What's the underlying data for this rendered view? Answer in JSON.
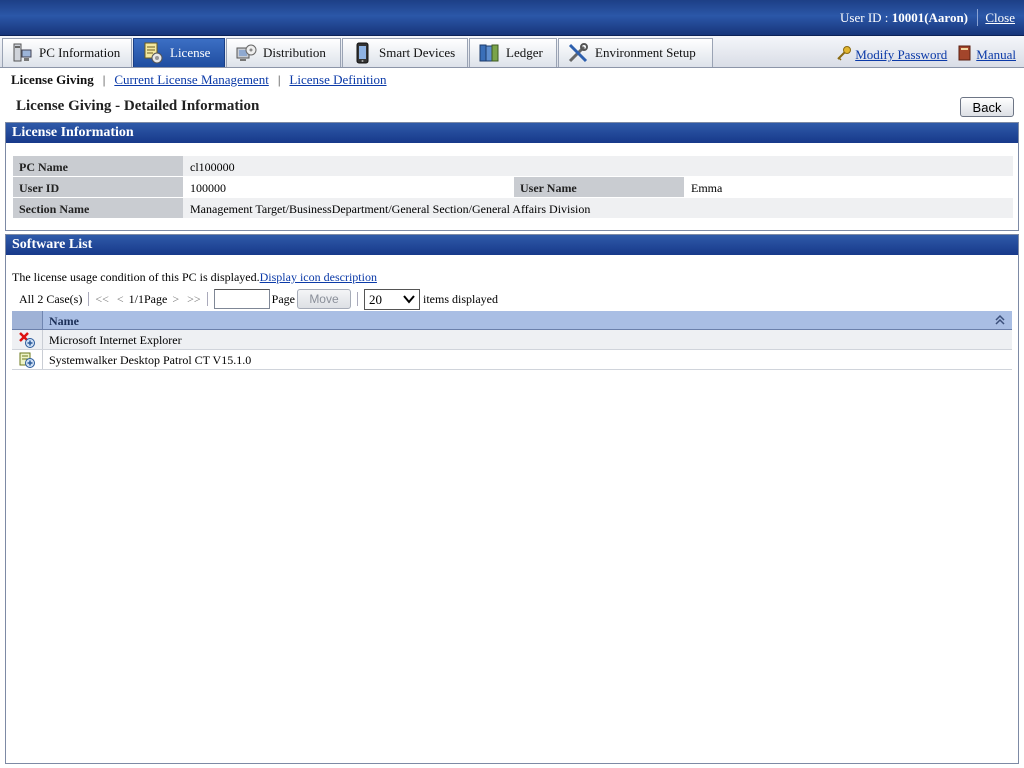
{
  "header": {
    "user_label": "User ID : ",
    "user_value": "10001(Aaron)",
    "close_label": "Close"
  },
  "tabs": [
    {
      "label": "PC Information",
      "icon": "pc-icon",
      "active": false
    },
    {
      "label": "License",
      "icon": "license-icon",
      "active": true
    },
    {
      "label": "Distribution",
      "icon": "distribution-icon",
      "active": false
    },
    {
      "label": "Smart Devices",
      "icon": "smart-device-icon",
      "active": false
    },
    {
      "label": "Ledger",
      "icon": "ledger-icon",
      "active": false
    },
    {
      "label": "Environment Setup",
      "icon": "tools-icon",
      "active": false
    }
  ],
  "top_links": {
    "modify_password": "Modify Password",
    "manual": "Manual"
  },
  "subnav": {
    "current": "License Giving",
    "links": [
      "Current License Management",
      "License Definition"
    ]
  },
  "page": {
    "title": "License Giving - Detailed Information",
    "back_label": "Back"
  },
  "license_info": {
    "section_title": "License Information",
    "pc_name_label": "PC Name",
    "pc_name": "cl100000",
    "user_id_label": "User ID",
    "user_id": "100000",
    "user_name_label": "User Name",
    "user_name": "Emma",
    "section_name_label": "Section Name",
    "section_name": "Management Target/BusinessDepartment/General Section/General Affairs Division"
  },
  "software_list": {
    "section_title": "Software List",
    "description": "The license usage condition of this PC is displayed.",
    "icon_desc_link": "Display icon description",
    "pager": {
      "total": "All 2 Case(s)",
      "first": "<<",
      "prev": "<",
      "page_info": "1/1Page",
      "next": ">",
      "last": ">>",
      "page_input_value": "",
      "page_label": "Page",
      "move_label": "Move",
      "items_per_page": "20",
      "items_label": "items displayed"
    },
    "columns": {
      "name": "Name"
    },
    "rows": [
      {
        "name": "Microsoft Internet Explorer",
        "icon": "license-violation-icon"
      },
      {
        "name": "Systemwalker Desktop Patrol CT V15.1.0",
        "icon": "license-ok-icon"
      }
    ]
  },
  "colors": {
    "header_blue": "#1d3f86",
    "active_tab": "#2b5cb0",
    "table_header": "#a9bee4",
    "link": "#0b3aa8"
  }
}
